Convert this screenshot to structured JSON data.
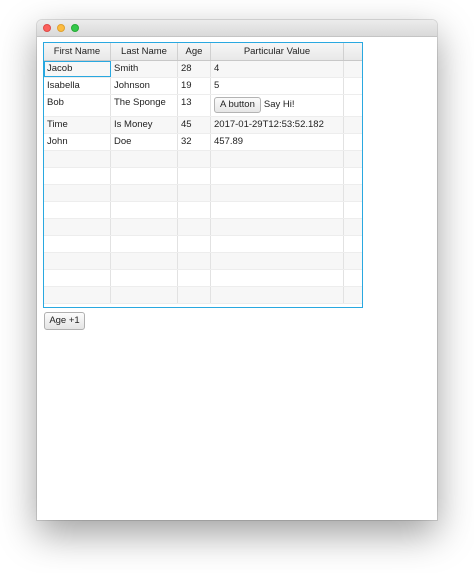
{
  "window": {
    "controls": [
      "close",
      "minimize",
      "zoom"
    ]
  },
  "table": {
    "columns": [
      "First Name",
      "Last Name",
      "Age",
      "Particular Value"
    ],
    "rows": [
      {
        "first": "Jacob",
        "last": "Smith",
        "age": "28",
        "value": "4"
      },
      {
        "first": "Isabella",
        "last": "Johnson",
        "age": "19",
        "value": "5"
      },
      {
        "first": "Bob",
        "last": "The Sponge",
        "age": "13",
        "value_button": "A button",
        "value_label": "Say Hi!"
      },
      {
        "first": "Time",
        "last": "Is Money",
        "age": "45",
        "value": "2017-01-29T12:53:52.182"
      },
      {
        "first": "John",
        "last": "Doe",
        "age": "32",
        "value": "457.89"
      }
    ],
    "empty_rows": 9
  },
  "actions": {
    "age_button": "Age +1"
  }
}
